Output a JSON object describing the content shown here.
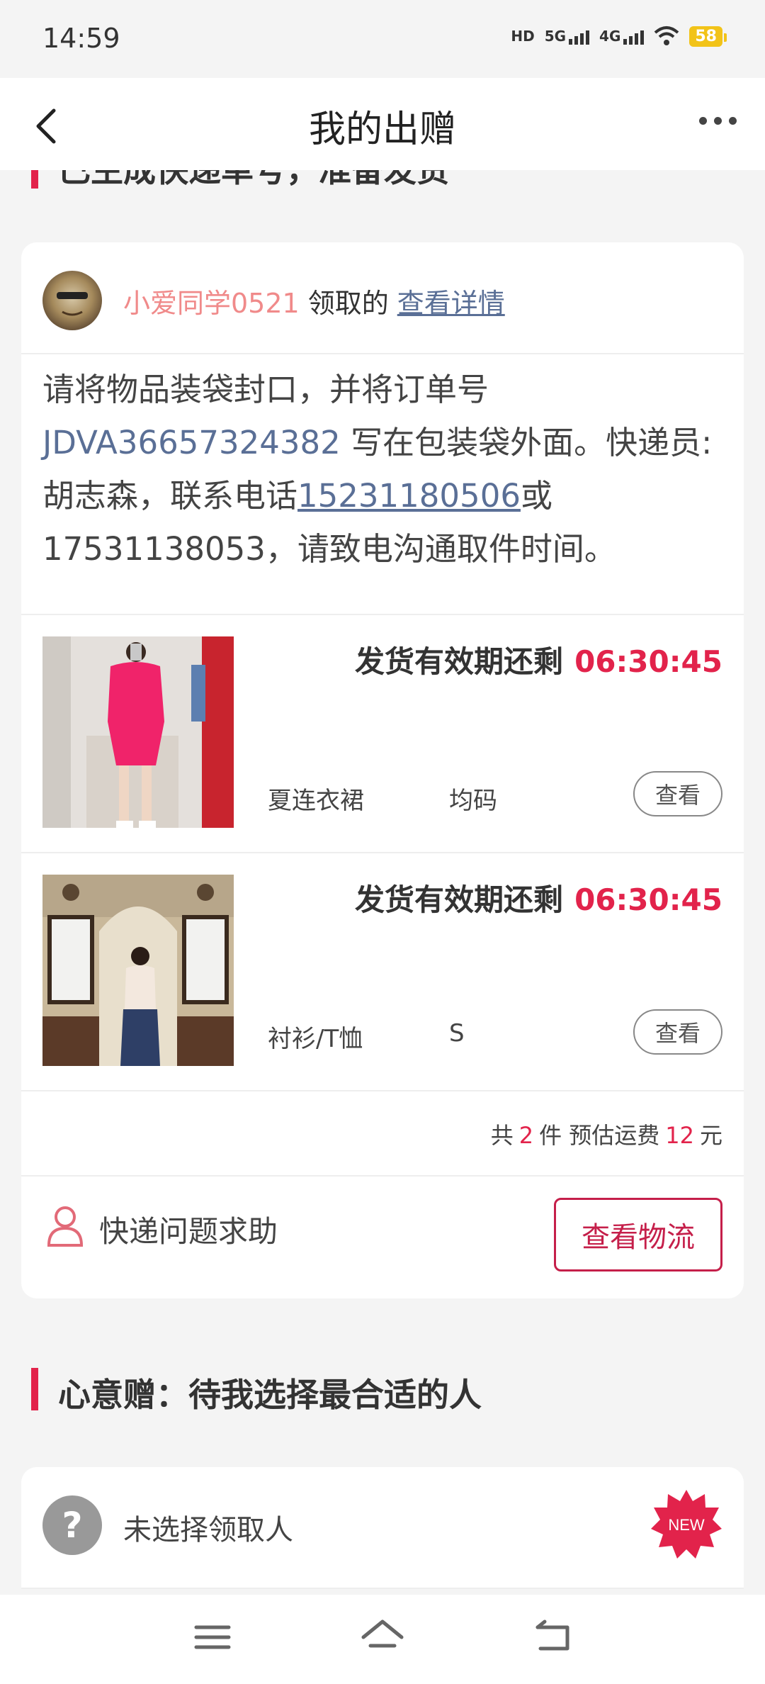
{
  "status_bar": {
    "time": "14:59",
    "hd_label": "HD",
    "net1": "5G",
    "net2": "4G",
    "battery": "58"
  },
  "header": {
    "title": "我的出赠"
  },
  "prev_section": {
    "heading": "已生成快递单号，准备发货"
  },
  "order_card": {
    "receiver": {
      "name": "小爱同学0521",
      "suffix": "领取的",
      "detail_link": "查看详情"
    },
    "instructions": {
      "part1": "请将物品装袋封口，并将订单号 ",
      "order_no": "JDVA36657324382",
      "part2": " 写在包装袋外面。快递员:胡志森，联系电话",
      "phone1": "15231180506",
      "part3": "或17531138053，请致电沟通取件时间。"
    },
    "items": [
      {
        "deadline_label": "发货有效期还剩",
        "deadline_time": "06:30:45",
        "name": "夏连衣裙",
        "size": "均码",
        "view_label": "查看"
      },
      {
        "deadline_label": "发货有效期还剩",
        "deadline_time": "06:30:45",
        "name": "衬衫/T恤",
        "size": "S",
        "view_label": "查看"
      }
    ],
    "summary": {
      "prefix": "共",
      "count": "2",
      "mid": "件 预估运费",
      "fee": "12",
      "unit": "元"
    },
    "help_text": "快递问题求助",
    "logistics_button": "查看物流"
  },
  "section2": {
    "title": "心意赠：待我选择最合适的人",
    "no_receiver_text": "未选择领取人",
    "new_badge": "NEW"
  },
  "colors": {
    "accent": "#e2234b",
    "link": "#5a6f96",
    "receiver_name": "#f08a8a"
  }
}
